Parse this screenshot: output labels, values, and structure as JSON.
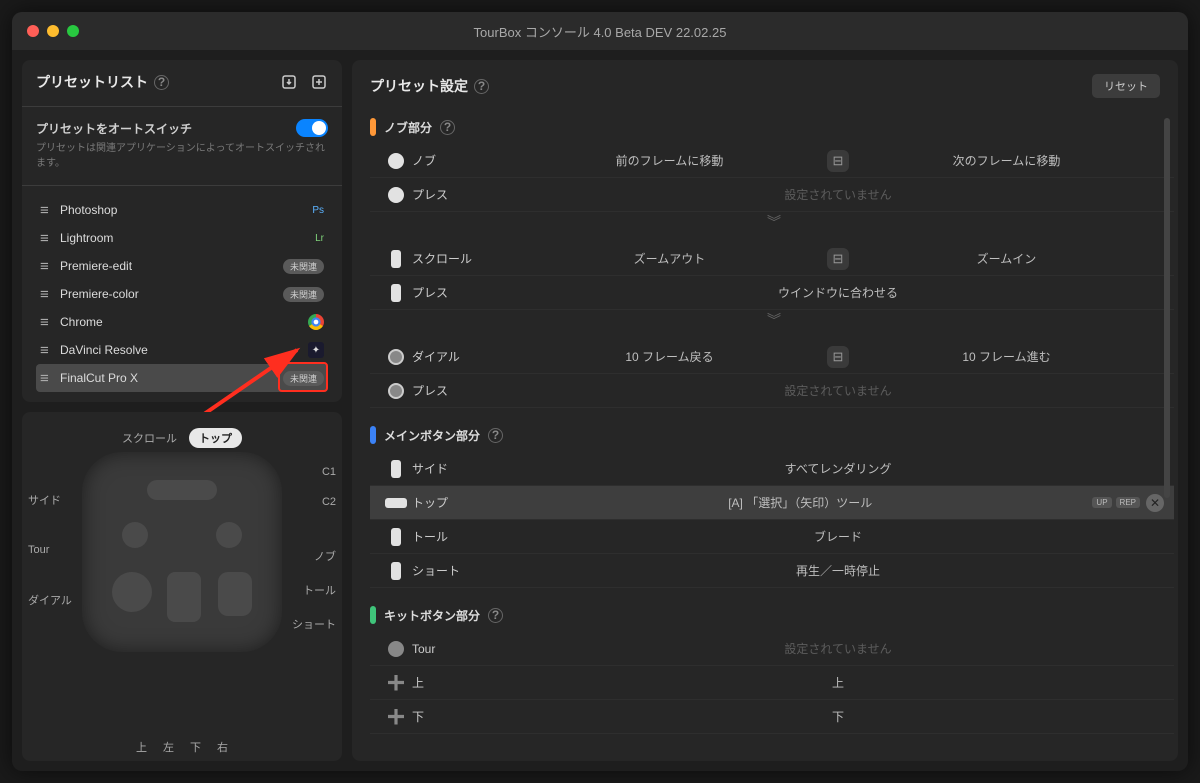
{
  "window_title": "TourBox コンソール 4.0 Beta DEV 22.02.25",
  "sidebar": {
    "title": "プリセットリスト",
    "autoswitch_label": "プリセットをオートスイッチ",
    "autoswitch_desc": "プリセットは関連アプリケーションによってオートスイッチされます。",
    "presets": [
      {
        "name": "Photoshop",
        "tag": "Ps",
        "tagClass": "tag"
      },
      {
        "name": "Lightroom",
        "tag": "Lr",
        "tagClass": "tag lr"
      },
      {
        "name": "Premiere-edit",
        "pill": "未関連"
      },
      {
        "name": "Premiere-color",
        "pill": "未関連"
      },
      {
        "name": "Chrome",
        "icon": "chrome"
      },
      {
        "name": "DaVinci Resolve",
        "icon": "davinci"
      },
      {
        "name": "FinalCut Pro X",
        "pill": "未関連",
        "selected": true,
        "highlight": true
      }
    ],
    "device_labels": {
      "scroll": "スクロール",
      "top": "トップ",
      "c1": "C1",
      "c2": "C2",
      "side": "サイド",
      "tour": "Tour",
      "dial": "ダイアル",
      "knob": "ノブ",
      "tall": "トール",
      "short": "ショート",
      "up": "上",
      "left": "左",
      "down": "下",
      "right": "右"
    }
  },
  "settings": {
    "title": "プリセット設定",
    "reset": "リセット",
    "sections": [
      {
        "color": "orange",
        "title": "ノブ部分",
        "rows": [
          {
            "ic": "knob",
            "name": "ノブ",
            "left": "前のフレームに移動",
            "sep": true,
            "right": "次のフレームに移動"
          },
          {
            "ic": "knob",
            "name": "プレス",
            "center": "設定されていません",
            "muted": true
          }
        ],
        "expand": true
      },
      {
        "rows": [
          {
            "ic": "bar",
            "name": "スクロール",
            "left": "ズームアウト",
            "sep": true,
            "right": "ズームイン"
          },
          {
            "ic": "bar",
            "name": "プレス",
            "center": "ウインドウに合わせる"
          }
        ],
        "expand": true
      },
      {
        "rows": [
          {
            "ic": "dial",
            "name": "ダイアル",
            "left": "10 フレーム戻る",
            "sep": true,
            "right": "10 フレーム進む"
          },
          {
            "ic": "dial",
            "name": "プレス",
            "center": "設定されていません",
            "muted": true
          }
        ]
      },
      {
        "color": "blue",
        "title": "メインボタン部分",
        "rows": [
          {
            "ic": "bar",
            "name": "サイド",
            "center": "すべてレンダリング"
          },
          {
            "ic": "barw",
            "name": "トップ",
            "center": "[A] 「選択」（矢印）ツール",
            "hi": true,
            "extras": true
          },
          {
            "ic": "bar",
            "name": "トール",
            "center": "ブレード"
          },
          {
            "ic": "bar",
            "name": "ショート",
            "center": "再生／一時停止"
          }
        ]
      },
      {
        "color": "green",
        "title": "キットボタン部分",
        "rows": [
          {
            "ic": "knobdim",
            "name": "Tour",
            "center": "設定されていません",
            "muted": true
          },
          {
            "ic": "plus",
            "name": "上",
            "center": "上"
          },
          {
            "ic": "plus",
            "name": "下",
            "center": "下"
          }
        ]
      }
    ]
  }
}
